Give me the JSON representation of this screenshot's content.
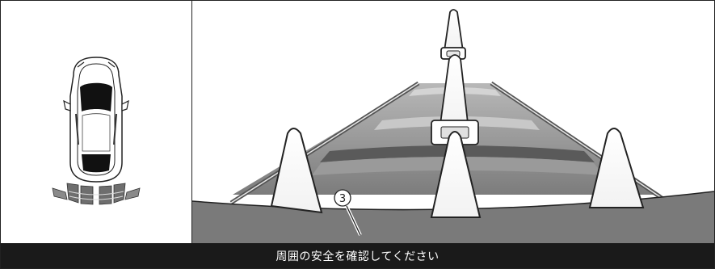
{
  "message_bar": {
    "text": "周囲の安全を確認してください"
  },
  "camera_view": {
    "callout_label": "3",
    "callout_circled": "③"
  },
  "icons": {
    "vehicle": "car-top-view-icon",
    "sensor": "rear-sensor-arcs-icon",
    "guide": "guide-line-cone-icon"
  },
  "colors": {
    "guide_band": "#8a8a8a",
    "ground": "#7a7a7a",
    "bar": "#1a1a1a",
    "outline": "#222222"
  }
}
